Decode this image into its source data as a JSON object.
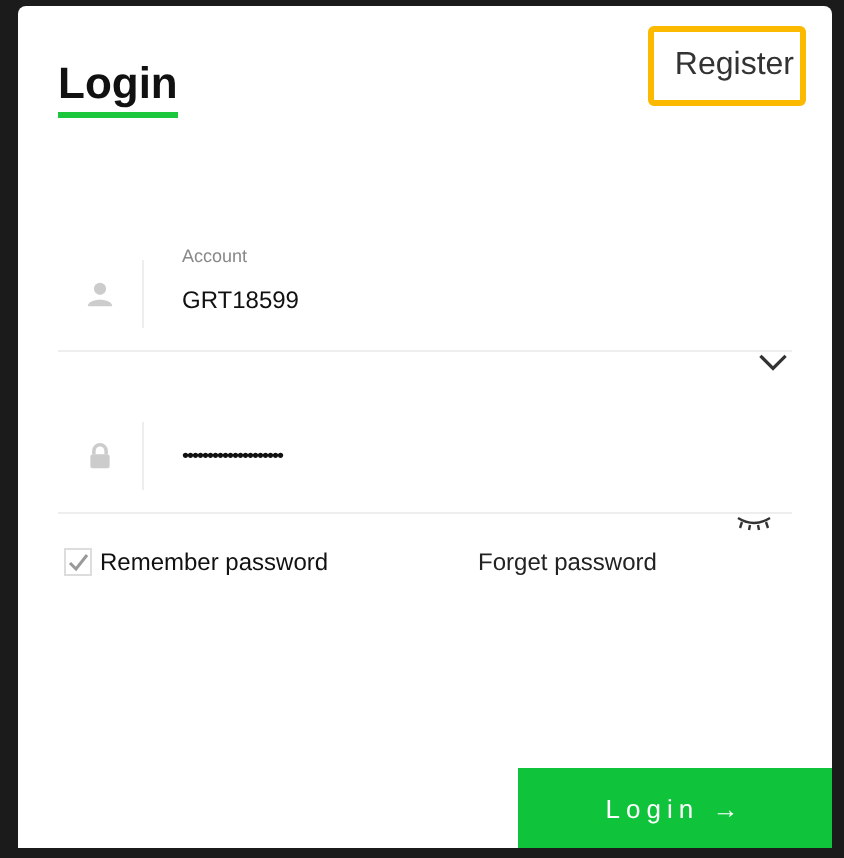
{
  "title": "Login",
  "register": "Register",
  "account": {
    "label": "Account",
    "value": "GRT18599"
  },
  "password": {
    "value": "••••••••••••••••••••"
  },
  "remember": {
    "label": "Remember password",
    "checked": true
  },
  "forget": "Forget password",
  "submit": {
    "label": "Login",
    "arrow": "→"
  }
}
